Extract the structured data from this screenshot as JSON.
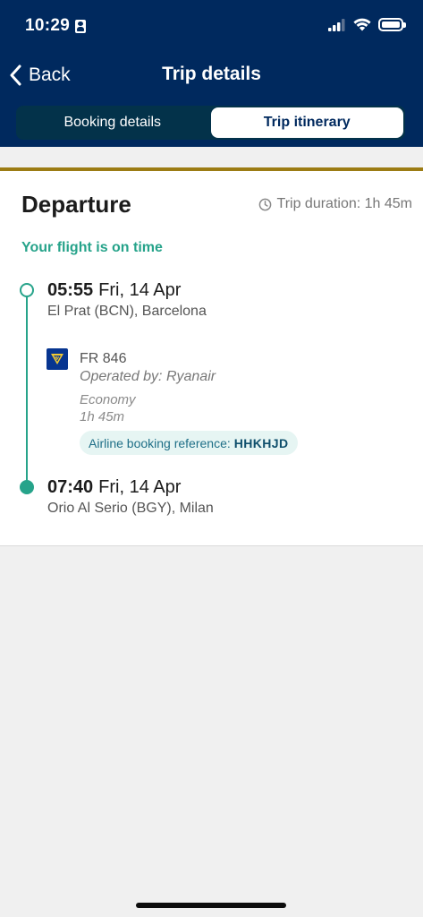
{
  "status_bar": {
    "time": "10:29"
  },
  "nav": {
    "back_label": "Back",
    "title": "Trip details"
  },
  "tabs": [
    {
      "label": "Booking details",
      "active": false
    },
    {
      "label": "Trip itinerary",
      "active": true
    }
  ],
  "departure": {
    "heading": "Departure",
    "duration_label": "Trip duration: 1h 45m",
    "status": "Your flight is on time",
    "origin": {
      "time": "05:55",
      "date": "Fri, 14 Apr",
      "place": "El Prat (BCN), Barcelona"
    },
    "flight": {
      "number": "FR 846",
      "operated_by": "Operated by: Ryanair",
      "cabin": "Economy",
      "duration": "1h 45m",
      "reference_label": "Airline booking reference:",
      "reference_code": "HHKHJD"
    },
    "destination": {
      "time": "07:40",
      "date": "Fri, 14 Apr",
      "place": "Orio Al Serio (BGY), Milan"
    }
  },
  "colors": {
    "header_bg": "#00295e",
    "accent_green": "#26a38a",
    "gold_rule": "#9c7c14"
  },
  "icons": [
    "person-id-icon",
    "signal-icon",
    "wifi-icon",
    "battery-icon",
    "chevron-left-icon",
    "clock-icon",
    "ryanair-harp-logo"
  ]
}
